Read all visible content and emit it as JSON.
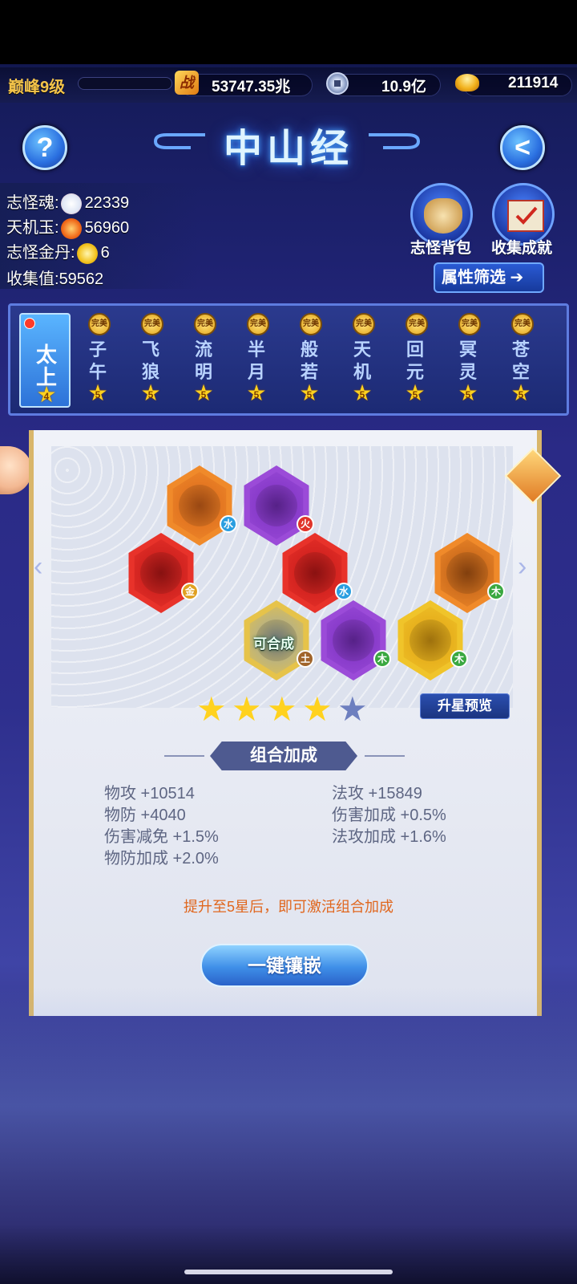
{
  "header": {
    "level_label": "巅峰9级",
    "power_icon_text": "战",
    "power_value": "53747.35兆",
    "silver_value": "10.9亿",
    "gold_value": "211914"
  },
  "title": "中山经",
  "help_button": "?",
  "back_button": "<",
  "stats": [
    {
      "label": "志怪魂:",
      "value": "22339"
    },
    {
      "label": "天机玉:",
      "value": "56960"
    },
    {
      "label": "志怪金丹:",
      "value": "6"
    },
    {
      "label": "收集值:",
      "value": "59562"
    }
  ],
  "corner_buttons": {
    "bag_label": "志怪背包",
    "achieve_label": "收集成就",
    "filter_label": "属性筛选 ➔"
  },
  "tabs": [
    {
      "name_top": "太",
      "name_bottom": "上",
      "stars": "4",
      "badge": "",
      "active": true
    },
    {
      "name_top": "子",
      "name_bottom": "午",
      "stars": "5",
      "badge": "完美"
    },
    {
      "name_top": "飞",
      "name_bottom": "狼",
      "stars": "5",
      "badge": "完美"
    },
    {
      "name_top": "流",
      "name_bottom": "明",
      "stars": "5",
      "badge": "完美"
    },
    {
      "name_top": "半",
      "name_bottom": "月",
      "stars": "5",
      "badge": "完美"
    },
    {
      "name_top": "般",
      "name_bottom": "若",
      "stars": "5",
      "badge": "完美"
    },
    {
      "name_top": "天",
      "name_bottom": "机",
      "stars": "5",
      "badge": "完美"
    },
    {
      "name_top": "回",
      "name_bottom": "元",
      "stars": "5",
      "badge": "完美"
    },
    {
      "name_top": "冥",
      "name_bottom": "灵",
      "stars": "5",
      "badge": "完美"
    },
    {
      "name_top": "苍",
      "name_bottom": "空",
      "stars": "5",
      "badge": "完美"
    }
  ],
  "hexes": [
    {
      "color": "#f08a2a",
      "inner": "#d9661a",
      "element": "水",
      "elem_color": "#2a9ee0"
    },
    {
      "color": "#9b4bd8",
      "inner": "#7a2fc0",
      "element": "火",
      "elem_color": "#e0342a"
    },
    {
      "color": "#e8322a",
      "inner": "#c01818",
      "element": "金",
      "elem_color": "#e0a020"
    },
    {
      "color": "#e8322a",
      "inner": "#c41818",
      "element": "水",
      "elem_color": "#2a9ee0"
    },
    {
      "color": "#f08a2a",
      "inner": "#b85a14",
      "element": "木",
      "elem_color": "#3aa840"
    },
    {
      "color": "#e6c34a",
      "inner": "#9aa6a6",
      "element": "土",
      "elem_color": "#a0642a",
      "overlay": "可合成"
    },
    {
      "color": "#9b4bd8",
      "inner": "#7a2fc0",
      "element": "木",
      "elem_color": "#3aa840"
    },
    {
      "color": "#f0c42a",
      "inner": "#e0a012",
      "element": "木",
      "elem_color": "#3aa840"
    }
  ],
  "star_rating": {
    "filled": 4,
    "total": 5
  },
  "preview_button": "升星预览",
  "combo_title": "组合加成",
  "bonuses_left": [
    "物攻 +10514",
    "物防 +4040",
    "伤害减免 +1.5%",
    "物防加成 +2.0%"
  ],
  "bonuses_right": [
    "法攻 +15849",
    "伤害加成 +0.5%",
    "法攻加成 +1.6%"
  ],
  "hint": "提升至5星后，即可激活组合加成",
  "inlay_button": "一键镶嵌",
  "colors": {
    "accent": "#2a6fe0",
    "gold": "#ffd21f",
    "hint": "#e0671f",
    "bonus_text": "#5e6683"
  }
}
